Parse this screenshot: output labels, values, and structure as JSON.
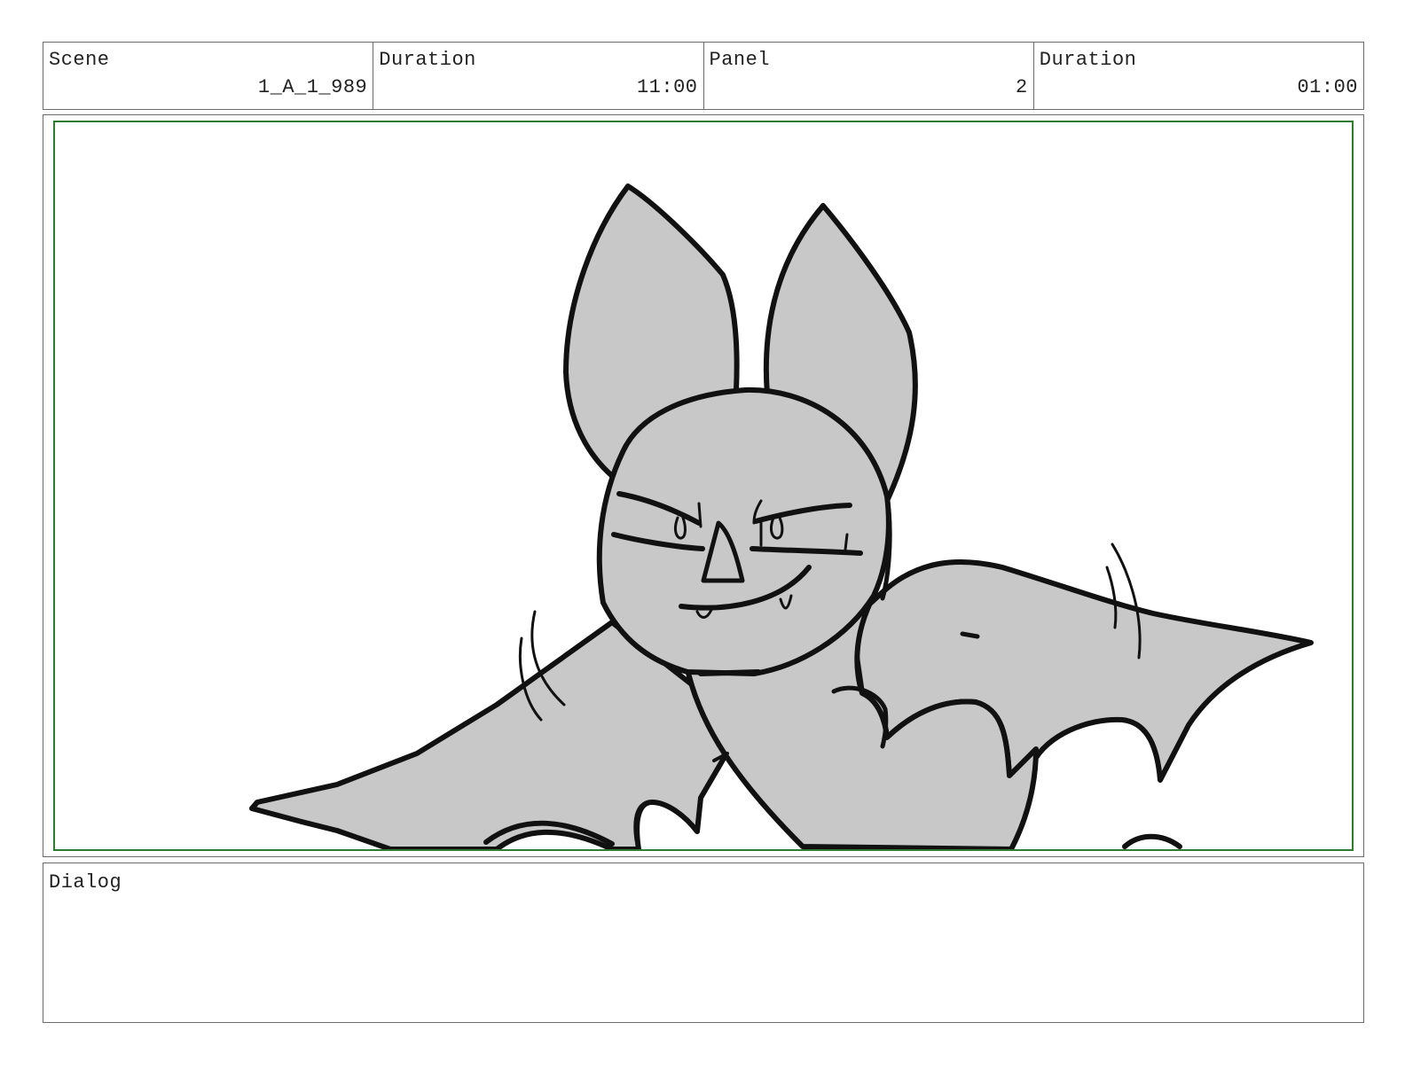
{
  "header": {
    "scene_label": "Scene",
    "scene_value": "1_A_1_989",
    "scene_duration_label": "Duration",
    "scene_duration_value": "11:00",
    "panel_label": "Panel",
    "panel_value": "2",
    "panel_duration_label": "Duration",
    "panel_duration_value": "01:00"
  },
  "panel": {
    "subject": "bat-drawing",
    "fill_color": "#c8c8c8",
    "line_color": "#111111",
    "safe_frame_color": "#2e7d32"
  },
  "dialog": {
    "label": "Dialog",
    "text": ""
  }
}
